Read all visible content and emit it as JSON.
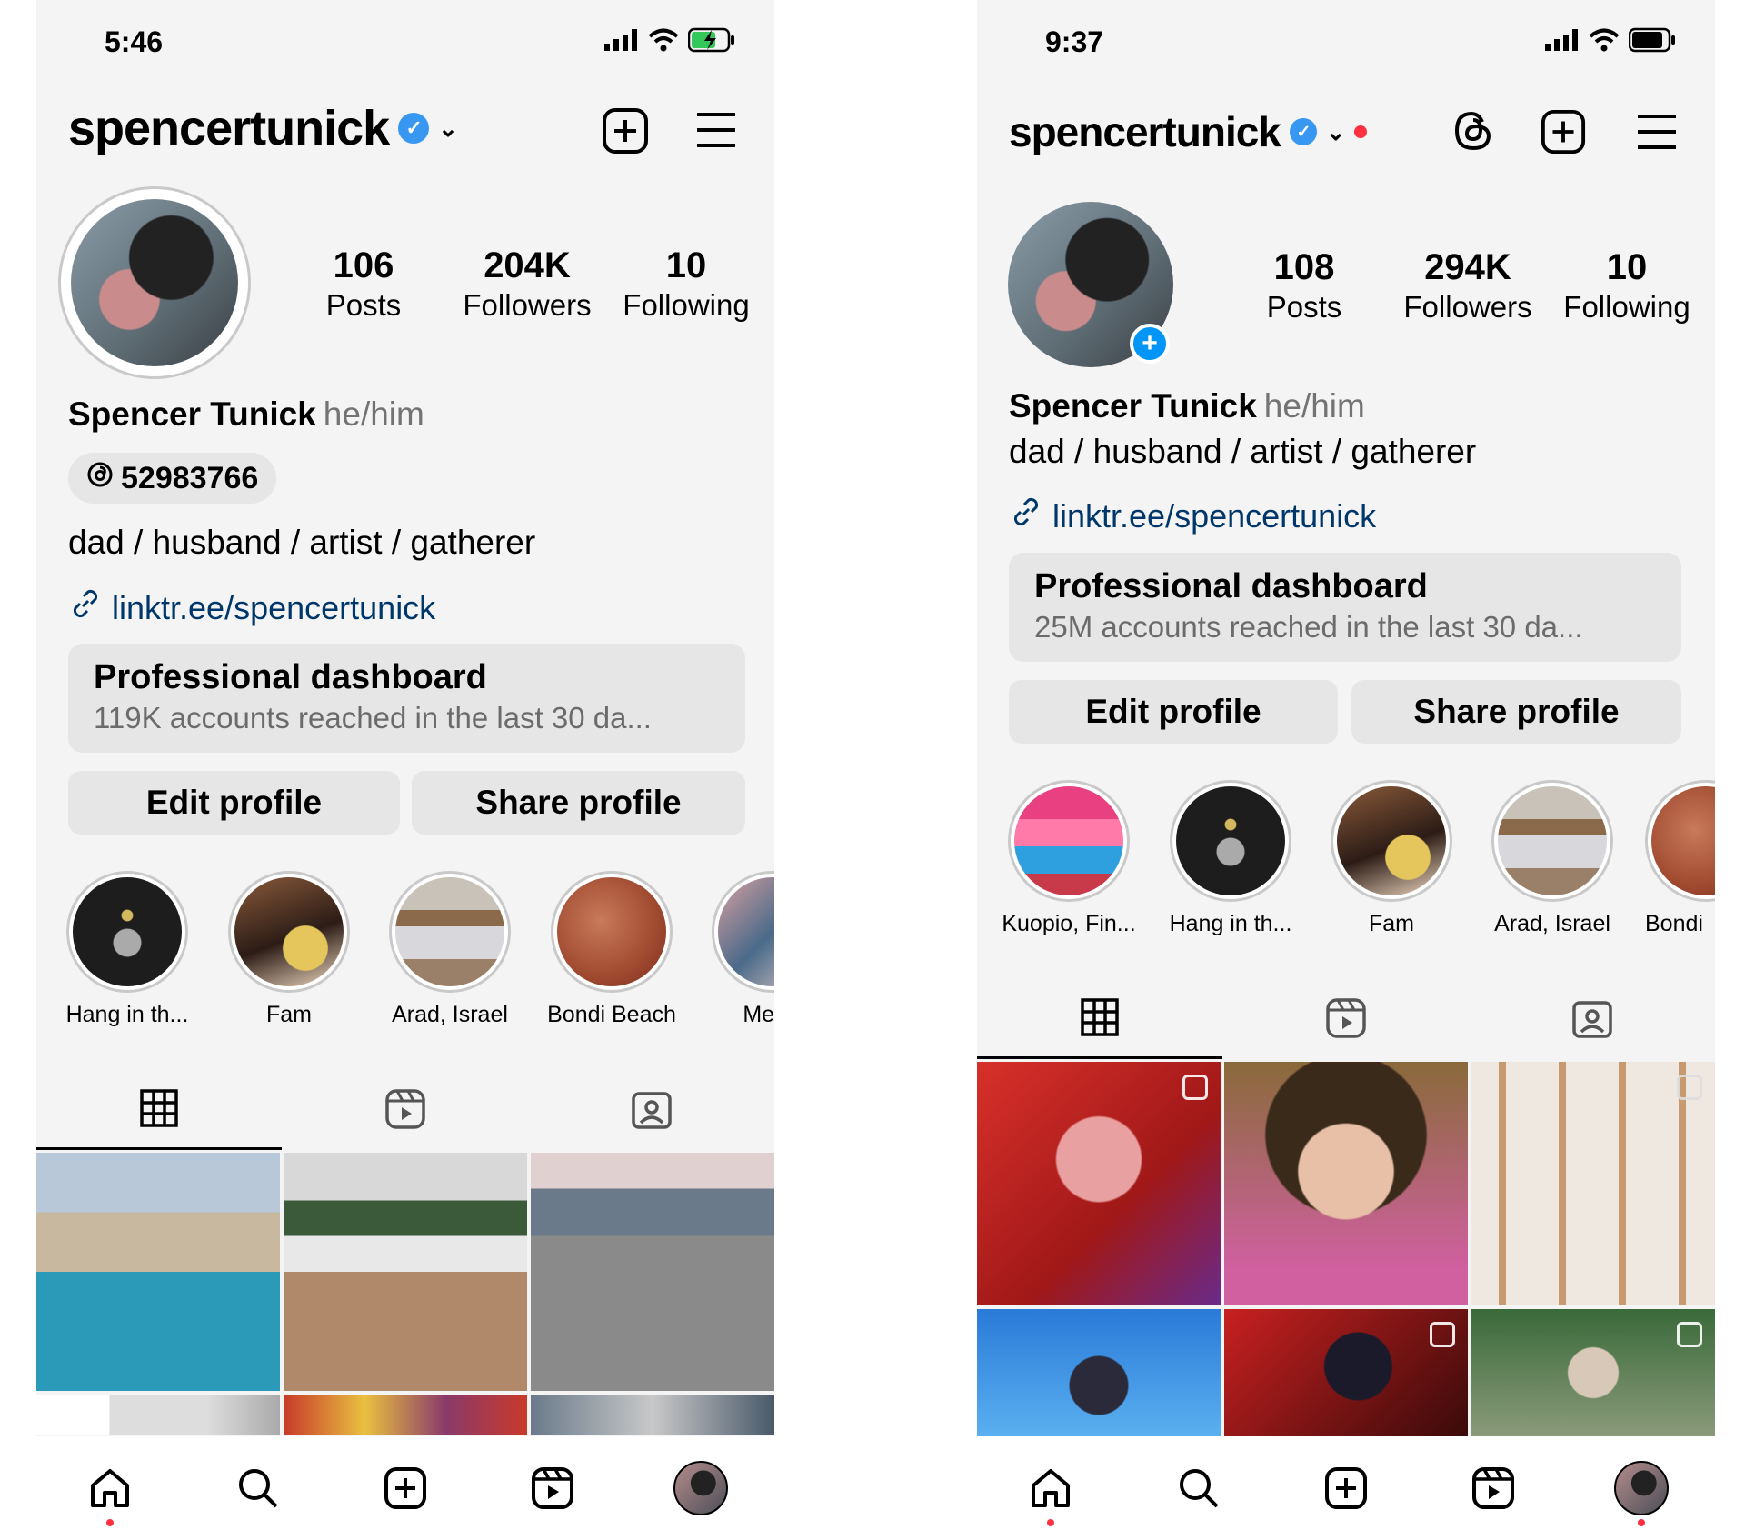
{
  "left": {
    "status": {
      "time": "5:46"
    },
    "header": {
      "username": "spencertunick"
    },
    "stats": [
      {
        "num": "106",
        "label": "Posts"
      },
      {
        "num": "204K",
        "label": "Followers"
      },
      {
        "num": "10",
        "label": "Following"
      }
    ],
    "profile": {
      "name": "Spencer Tunick",
      "pronouns": "he/him",
      "threads_number": "52983766",
      "bio": "dad / husband / artist / gatherer",
      "link": "linktr.ee/spencertunick"
    },
    "dashboard": {
      "title": "Professional dashboard",
      "subtitle": "119K accounts reached in the last 30 da..."
    },
    "buttons": {
      "edit": "Edit profile",
      "share": "Share profile"
    },
    "highlights": [
      {
        "label": "Hang in th..."
      },
      {
        "label": "Fam"
      },
      {
        "label": "Arad, Israel"
      },
      {
        "label": "Bondi Beach"
      },
      {
        "label": "Mexic"
      }
    ]
  },
  "right": {
    "status": {
      "time": "9:37"
    },
    "header": {
      "username": "spencertunick"
    },
    "stats": [
      {
        "num": "108",
        "label": "Posts"
      },
      {
        "num": "294K",
        "label": "Followers"
      },
      {
        "num": "10",
        "label": "Following"
      }
    ],
    "profile": {
      "name": "Spencer Tunick",
      "pronouns": "he/him",
      "bio": "dad / husband / artist / gatherer",
      "link": "linktr.ee/spencertunick"
    },
    "dashboard": {
      "title": "Professional dashboard",
      "subtitle": "25M accounts reached in the last 30 da..."
    },
    "buttons": {
      "edit": "Edit profile",
      "share": "Share profile"
    },
    "highlights": [
      {
        "label": "Kuopio, Fin..."
      },
      {
        "label": "Hang in th..."
      },
      {
        "label": "Fam"
      },
      {
        "label": "Arad, Israel"
      },
      {
        "label": "Bondi"
      }
    ]
  },
  "colors": {
    "link": "#00376b",
    "verified": "#3897f0",
    "notification": "#ff3040",
    "add_badge": "#0095f6"
  },
  "icons": [
    "verified-badge-icon",
    "chevron-down-icon",
    "threads-icon",
    "create-icon",
    "menu-icon",
    "link-icon",
    "grid-icon",
    "reels-icon",
    "tagged-icon",
    "home-icon",
    "search-icon",
    "profile-icon"
  ]
}
